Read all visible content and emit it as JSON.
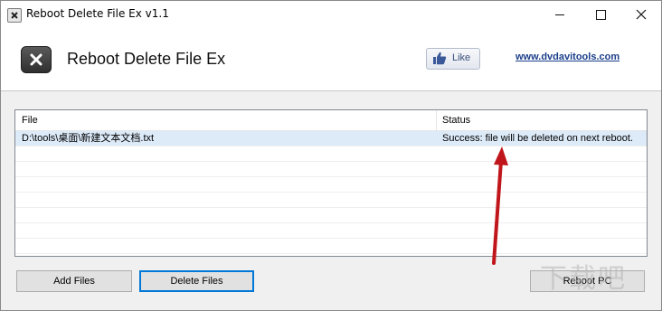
{
  "window": {
    "title": "Reboot Delete File Ex v1.1"
  },
  "header": {
    "title": "Reboot Delete File Ex",
    "like_label": "Like",
    "site_link": "www.dvdavitools.com"
  },
  "list": {
    "columns": [
      "File",
      "Status"
    ],
    "rows": [
      {
        "file": "D:\\tools\\桌面\\新建文本文档.txt",
        "status": "Success: file will be deleted on next reboot.",
        "selected": true
      }
    ],
    "empty_rows": 7
  },
  "buttons": {
    "add": "Add Files",
    "delete": "Delete Files",
    "reboot": "Reboot PC"
  },
  "watermark": "下载吧",
  "colors": {
    "selection": "#ddeaf8",
    "focus_border": "#0078d7",
    "link": "#1a3e8a",
    "annotation_arrow": "#c0161b"
  },
  "icons": [
    "app-icon",
    "logo-icon",
    "thumbs-up-icon",
    "minimize-icon",
    "maximize-icon",
    "close-icon"
  ]
}
